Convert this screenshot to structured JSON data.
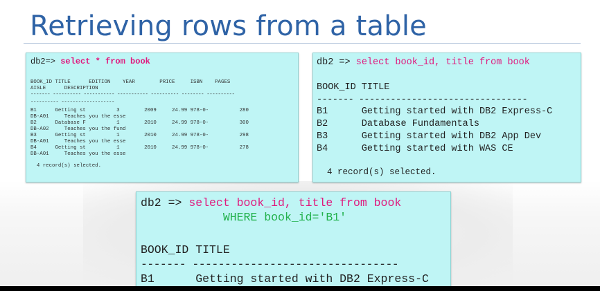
{
  "slide": {
    "title": "Retrieving rows from a table"
  },
  "panel1": {
    "prompt": "db2=> ",
    "command": "select * from book",
    "header_line1": "BOOK_ID TITLE      EDITION    YEAR        PRICE     ISBN    PAGES",
    "header_line2": "AISLE      DESCRIPTION",
    "separator_line1": "------- ---------- ----------- ----------- ---------- -------- ----------",
    "separator_line2": "---------- -------------------",
    "rows": [
      "B1      Getting st          3        2009     24.99 978-0-          280",
      "DB-A01     Teaches you the esse",
      "B2      Database F          1        2010     24.99 978-0-          300",
      "DB-A02     Teaches you the fund",
      "B3      Getting st          1        2010     24.99 978-0-          298",
      "DB-A01     Teaches you the esse",
      "B4      Getting st          1        2010     24.99 978-0-          278",
      "DB-A01     Teaches you the esse"
    ],
    "footer": "  4 record(s) selected."
  },
  "panel2": {
    "prompt": "db2 => ",
    "command": "select book_id, title from book",
    "header": "BOOK_ID TITLE",
    "separator": "------- --------------------------------",
    "rows": [
      "B1      Getting started with DB2 Express-C",
      "B2      Database Fundamentals",
      "B3      Getting started with DB2 App Dev",
      "B4      Getting started with WAS CE"
    ],
    "footer": "  4 record(s) selected."
  },
  "panel3": {
    "prompt": "db2 => ",
    "command": "select book_id, title from book",
    "where_indent": "            ",
    "where_clause": "WHERE book_id='B1'",
    "header": "BOOK_ID TITLE",
    "separator": "------- --------------------------------",
    "rows": [
      "B1      Getting started with DB2 Express-C"
    ]
  },
  "colors": {
    "title": "#2f63a6",
    "panel_bg": "#bff5f5",
    "keyword": "#e0197d",
    "where_keyword": "#22b14c"
  }
}
